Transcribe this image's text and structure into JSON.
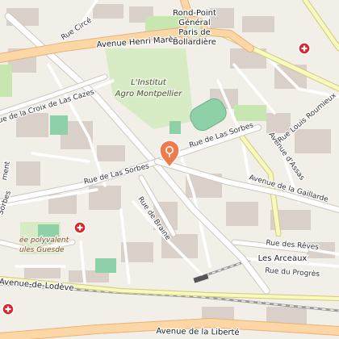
{
  "map": {
    "places": {
      "rond_point": [
        "Rond-Point",
        "Général",
        "Paris de",
        "Bollardière"
      ],
      "institut": [
        "L'Institut",
        "Agro Montpellier"
      ],
      "lycee": [
        "ée polyvalent",
        "ules Guesde"
      ],
      "station": "Les Arceaux"
    },
    "streets": {
      "henri_mares": "Avenue Henri Marès",
      "las_sorbes_east": "Rue de Las Sorbes",
      "las_sorbes_west": "Rue de Las Sorbes",
      "gaillarde": "Avenue de la Gaillarde",
      "assas": "Avenue d'Assas",
      "louis_roumieux": "Rue Louis Roumieux",
      "croix_de_las_cazes": "Rue de la Croix de Las Cazes",
      "braine": "Rue de Braine",
      "reves": "Rue des Rêves",
      "progres": "Rue du Progrès",
      "lodeve": "Avenue-de-Lodève",
      "liberte": "Avenue de la Liberté",
      "circe": "Rue Circé",
      "left_sorbes": "Sorbes",
      "left_edge": "ment"
    },
    "markers": {
      "location_pin": "selected-location",
      "hospital_icon": "hospital-cross"
    },
    "colors": {
      "background": "#f2efe9",
      "major_road": "#fcd6a4",
      "secondary_road": "#f7fabf",
      "park": "#c8e6b0",
      "pitch": "#8ed0a8",
      "pin": "#ef7b4a",
      "hospital": "#d8262b"
    }
  }
}
